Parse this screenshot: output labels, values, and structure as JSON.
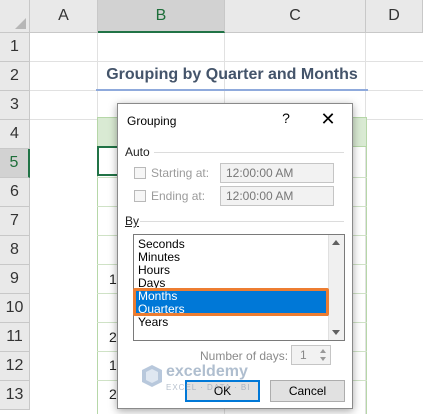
{
  "sheet": {
    "columns": [
      "A",
      "B",
      "C",
      "D"
    ],
    "rows": [
      "1",
      "2",
      "3",
      "4",
      "5",
      "6",
      "7",
      "8",
      "9",
      "10",
      "11",
      "12",
      "13"
    ],
    "selected_column": "B",
    "selected_row": "5",
    "title": "Grouping by Quarter and Months",
    "partial_cells": [
      "1",
      "2",
      "1",
      "2"
    ]
  },
  "dialog": {
    "title": "Grouping",
    "help": "?",
    "close": "✕",
    "auto_label": "Auto",
    "starting_label": "Starting at:",
    "starting_value": "12:00:00 AM",
    "ending_label": "Ending at:",
    "ending_value": "12:00:00 AM",
    "by_label": "By",
    "by_items": [
      "Seconds",
      "Minutes",
      "Hours",
      "Days",
      "Months",
      "Quarters",
      "Years"
    ],
    "selected_items": [
      "Months",
      "Quarters"
    ],
    "num_days_label": "Number of days:",
    "num_days_value": "1",
    "ok_label": "OK",
    "cancel_label": "Cancel"
  },
  "watermark": {
    "name": "exceldemy",
    "tagline": "EXCEL · DATA · BI"
  },
  "colors": {
    "selection": "#0078d7",
    "highlight": "#ed7d31",
    "excel_green": "#217346",
    "title_color": "#44546a"
  }
}
